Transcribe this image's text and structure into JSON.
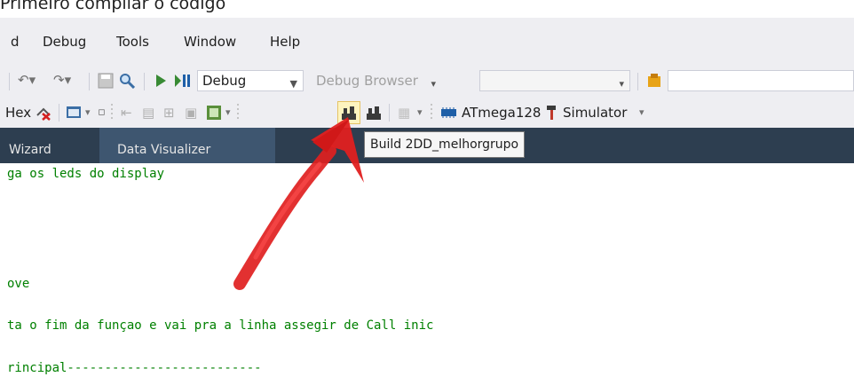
{
  "page": {
    "heading": "Primeiro compilar o código"
  },
  "menubar": {
    "items": [
      "d",
      "Debug",
      "Tools",
      "Window",
      "Help"
    ]
  },
  "toolbar": {
    "config_combo": "Debug",
    "debug_browser": "Debug Browser",
    "extra_combo": ""
  },
  "toolbar2": {
    "hex_label": "Hex",
    "device_label": "ATmega128",
    "tool_label": "Simulator"
  },
  "tabs": [
    {
      "label": "Wizard"
    },
    {
      "label": "Data Visualizer"
    }
  ],
  "tooltip": {
    "text": "Build 2DD_melhorgrupo"
  },
  "code": {
    "lines": [
      "ga os leds do display",
      "ove",
      "ta o fim da funçao e vai pra a linha assegir de Call inic",
      "rincipal--------------------------"
    ]
  },
  "colors": {
    "menubar_bg": "#eeeef2",
    "tab_bar_bg": "#2d3e50",
    "tab_active_bg": "#3e5670",
    "code_comment": "#008000",
    "annotation_arrow": "#e02020"
  }
}
